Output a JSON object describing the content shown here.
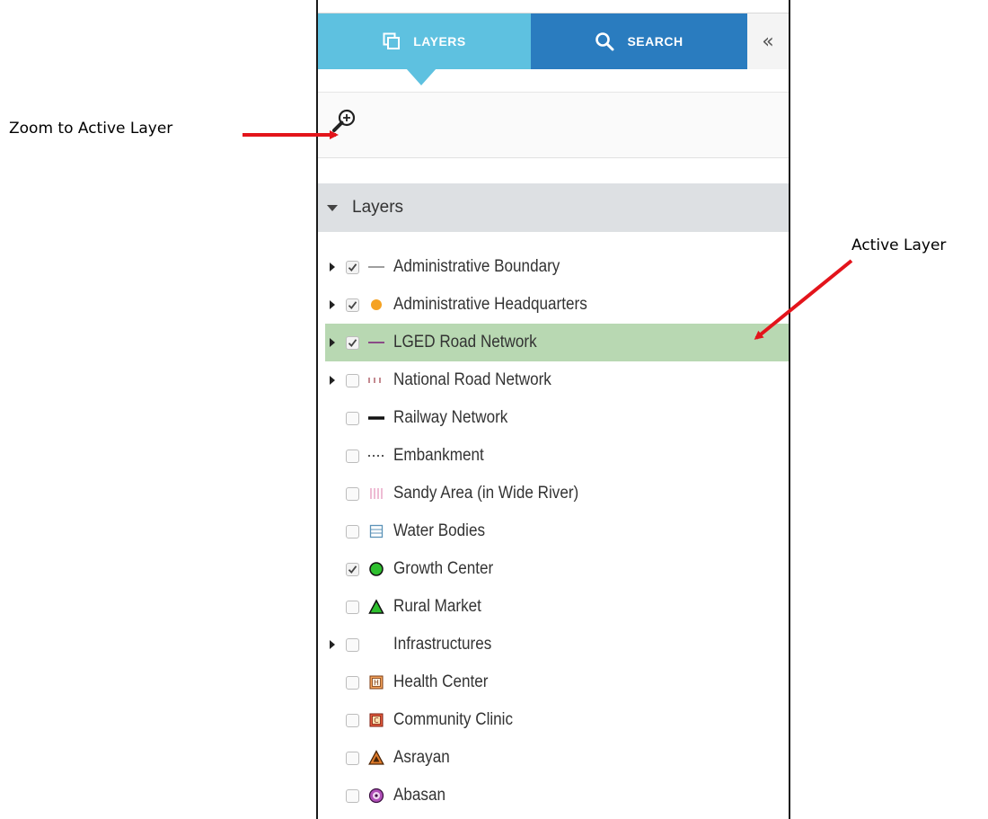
{
  "annotations": {
    "zoom_to_active": "Zoom to Active Layer",
    "active_layer": "Active Layer",
    "arrow_color": "#e3141b"
  },
  "tabs": {
    "layers_label": "LAYERS",
    "search_label": "SEARCH",
    "collapse_glyph": "«",
    "layers_color": "#5ec1e0",
    "search_color": "#2a7cbf"
  },
  "toolbar": {
    "zoom_icon": "zoom-in-icon"
  },
  "layers_section": {
    "title": "Layers",
    "active_row_color": "#b8d8b2"
  },
  "layers": [
    {
      "label": "Administrative Boundary",
      "checked": true,
      "expandable": true,
      "symbol": "gray-line-icon"
    },
    {
      "label": "Administrative Headquarters",
      "checked": true,
      "expandable": true,
      "symbol": "orange-dot-icon"
    },
    {
      "label": "LGED Road Network",
      "checked": true,
      "expandable": true,
      "active": true,
      "symbol": "purple-line-icon"
    },
    {
      "label": "National Road Network",
      "checked": false,
      "expandable": true,
      "symbol": "dashed-line-icon"
    },
    {
      "label": "Railway Network",
      "checked": false,
      "expandable": false,
      "symbol": "black-thick-line-icon"
    },
    {
      "label": "Embankment",
      "checked": false,
      "expandable": false,
      "symbol": "dotted-line-icon"
    },
    {
      "label": "Sandy Area (in Wide River)",
      "checked": false,
      "expandable": false,
      "symbol": "pink-hatch-icon"
    },
    {
      "label": "Water Bodies",
      "checked": false,
      "expandable": false,
      "symbol": "water-box-icon"
    },
    {
      "label": "Growth Center",
      "checked": true,
      "expandable": false,
      "symbol": "green-circle-icon"
    },
    {
      "label": "Rural Market",
      "checked": false,
      "expandable": false,
      "symbol": "green-triangle-icon"
    },
    {
      "label": "Infrastructures",
      "checked": false,
      "expandable": true,
      "symbol": "none"
    },
    {
      "label": "Health Center",
      "checked": false,
      "expandable": false,
      "symbol": "health-h-icon"
    },
    {
      "label": "Community Clinic",
      "checked": false,
      "expandable": false,
      "symbol": "clinic-c-icon"
    },
    {
      "label": "Asrayan",
      "checked": false,
      "expandable": false,
      "symbol": "asrayan-triangle-icon"
    },
    {
      "label": "Abasan",
      "checked": false,
      "expandable": false,
      "symbol": "abasan-circle-icon"
    }
  ]
}
